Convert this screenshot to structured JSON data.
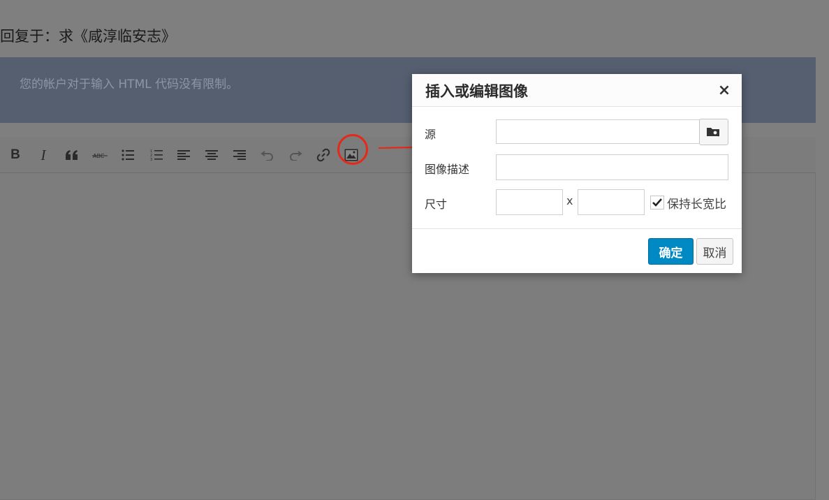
{
  "page": {
    "title": "回复于：求《咸淳临安志》",
    "notice": "您的帐户对于输入 HTML 代码没有限制。"
  },
  "toolbar": {
    "buttons": [
      {
        "name": "bold-icon",
        "glyph": "B"
      },
      {
        "name": "italic-icon",
        "glyph": "I"
      },
      {
        "name": "blockquote-icon",
        "glyph": "66"
      },
      {
        "name": "strikethrough-icon",
        "glyph": "ABC"
      },
      {
        "name": "bullet-list-icon"
      },
      {
        "name": "numbered-list-icon"
      },
      {
        "name": "align-left-icon"
      },
      {
        "name": "align-center-icon"
      },
      {
        "name": "align-right-icon"
      },
      {
        "name": "undo-icon"
      },
      {
        "name": "redo-icon"
      },
      {
        "name": "link-icon"
      },
      {
        "name": "image-icon"
      }
    ]
  },
  "dialog": {
    "title": "插入或编辑图像",
    "close": "×",
    "source_label": "源",
    "description_label": "图像描述",
    "dimensions_label": "尺寸",
    "dimension_separator": "x",
    "keep_ratio_label": "保持长宽比",
    "keep_ratio_checked": true,
    "ok_label": "确定",
    "cancel_label": "取消",
    "source_value": "",
    "description_value": "",
    "width_value": "",
    "height_value": ""
  },
  "colors": {
    "overlay_background": "#7f7f7f",
    "notice_background": "#555f70",
    "primary_button": "#0089c2",
    "annotation_red": "#e5281a"
  }
}
